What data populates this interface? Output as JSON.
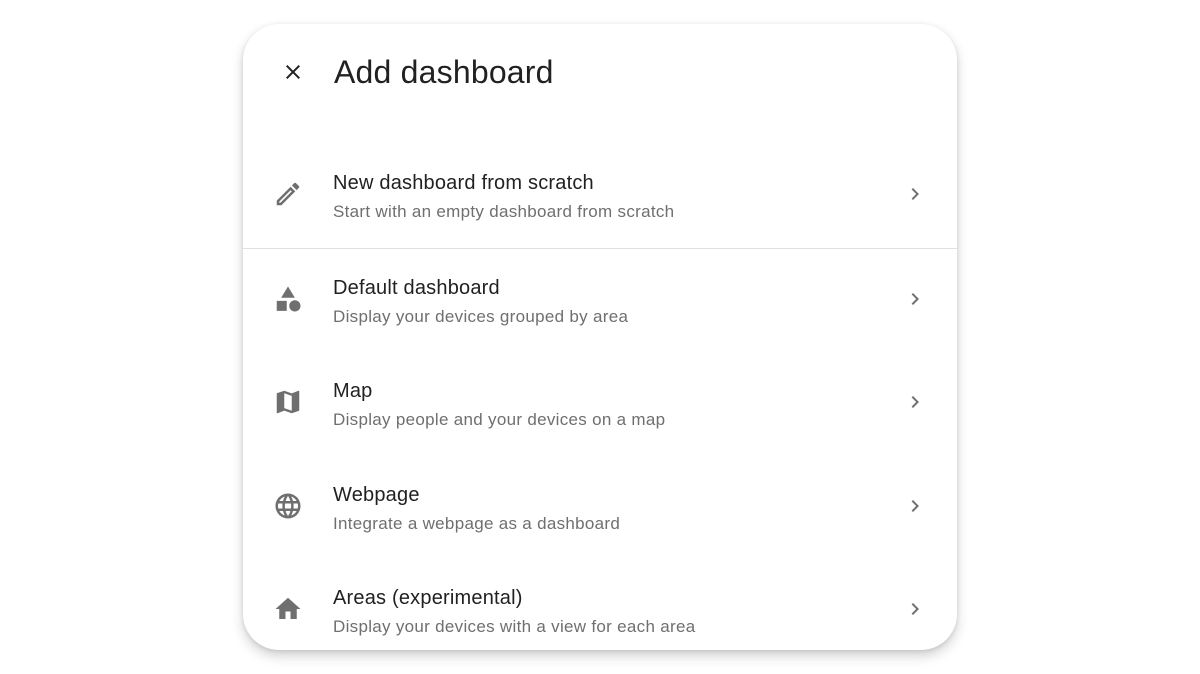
{
  "dialog": {
    "title": "Add dashboard"
  },
  "items": [
    {
      "icon": "pencil-icon",
      "title": "New dashboard from scratch",
      "subtitle": "Start with an empty dashboard from scratch"
    },
    {
      "icon": "shapes-icon",
      "title": "Default dashboard",
      "subtitle": "Display your devices grouped by area"
    },
    {
      "icon": "map-icon",
      "title": "Map",
      "subtitle": "Display people and your devices on a map"
    },
    {
      "icon": "globe-icon",
      "title": "Webpage",
      "subtitle": "Integrate a webpage as a dashboard"
    },
    {
      "icon": "home-icon",
      "title": "Areas (experimental)",
      "subtitle": "Display your devices with a view for each area"
    }
  ],
  "colors": {
    "icon": "#6f6f6f",
    "text_primary": "#212121",
    "text_secondary": "#6f6f6f",
    "divider": "#e0e0e0"
  }
}
